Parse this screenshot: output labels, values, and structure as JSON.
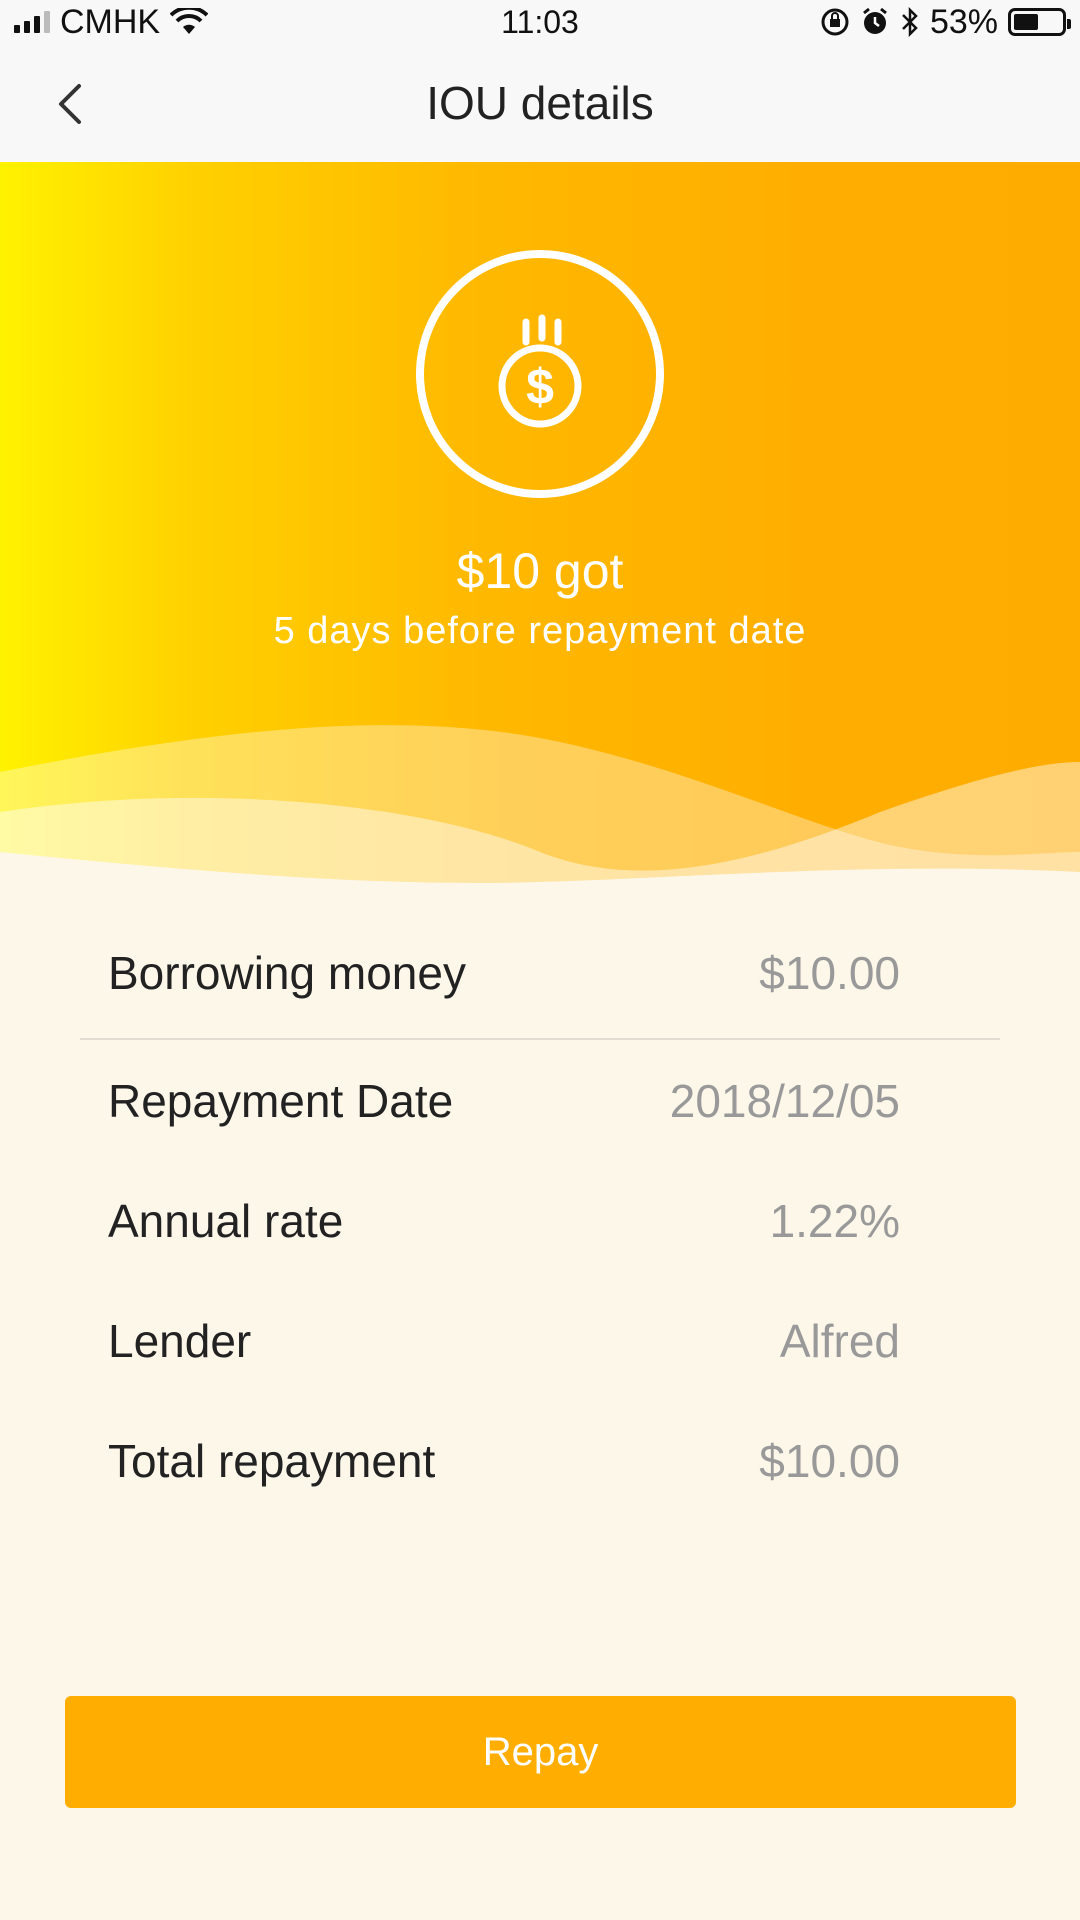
{
  "status_bar": {
    "carrier": "CMHK",
    "time": "11:03",
    "battery": "53%",
    "battery_level": 0.53,
    "icons": [
      "signal-icon",
      "wifi-icon",
      "orientation-lock-icon",
      "alarm-icon",
      "bluetooth-icon",
      "battery-icon"
    ]
  },
  "nav": {
    "title": "IOU details",
    "back_icon": "chevron-left-icon"
  },
  "hero": {
    "icon": "coin-dollar-icon",
    "amount": "$10 got",
    "subtitle": "5 days before repayment date",
    "colors": {
      "gradient_start": "#fff200",
      "gradient_end": "#ffac00"
    }
  },
  "details": {
    "rows": [
      {
        "label": "Borrowing money",
        "value": "$10.00"
      },
      {
        "label": "Repayment Date",
        "value": "2018/12/05"
      },
      {
        "label": "Annual rate",
        "value": "1.22%"
      },
      {
        "label": "Lender",
        "value": "Alfred"
      },
      {
        "label": "Total repayment",
        "value": "$10.00"
      }
    ]
  },
  "actions": {
    "repay_label": "Repay",
    "accent": "#ffae00"
  }
}
